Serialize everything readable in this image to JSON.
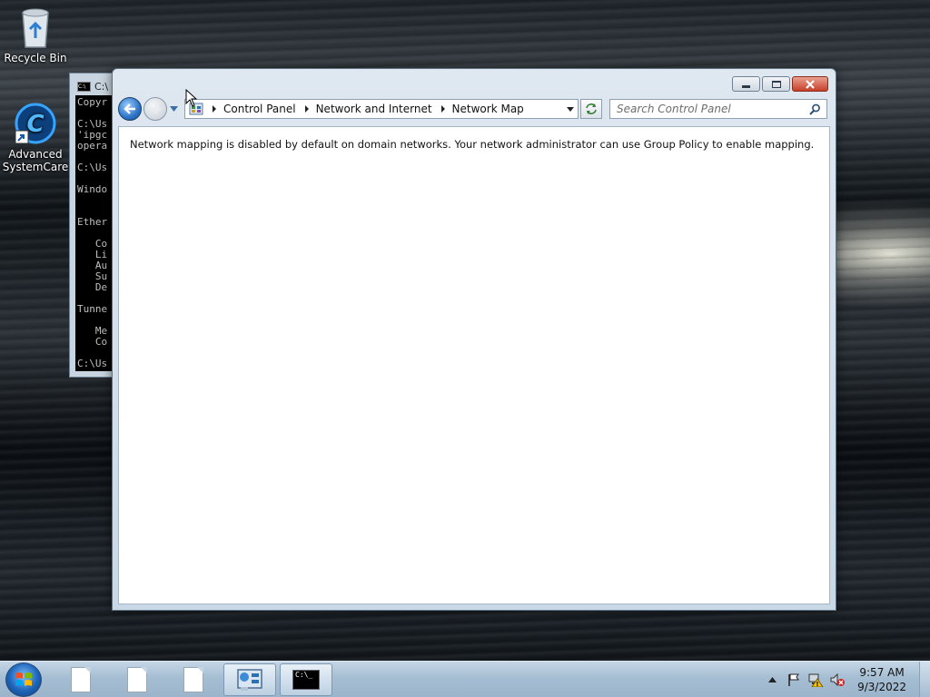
{
  "desktop": {
    "icons": [
      {
        "label": "Recycle Bin",
        "icon": "recycle-bin-icon"
      },
      {
        "label": "Advanced SystemCare",
        "icon": "advanced-systemcare-icon"
      }
    ]
  },
  "console": {
    "title": "C:\\",
    "lines": [
      "Copyr",
      "",
      "C:\\Us",
      "'ipgc",
      "opera",
      "",
      "C:\\Us",
      "",
      "Windo",
      "",
      "",
      "Ether",
      "",
      "   Co",
      "   Li",
      "   Au",
      "   Su",
      "   De",
      "",
      "Tunne",
      "",
      "   Me",
      "   Co",
      "",
      "C:\\Us"
    ]
  },
  "explorer": {
    "breadcrumb": [
      "Control Panel",
      "Network and Internet",
      "Network Map"
    ],
    "search_placeholder": "Search Control Panel",
    "message": "Network mapping is disabled by default on domain networks. Your network administrator can use Group Policy to enable mapping."
  },
  "taskbar": {
    "items": [
      "document-icon",
      "document-icon",
      "document-icon",
      "control-panel-icon",
      "command-prompt-icon"
    ],
    "cmd_label": "C:\\_",
    "clock": {
      "time": "9:57 AM",
      "date": "9/3/2022"
    }
  }
}
